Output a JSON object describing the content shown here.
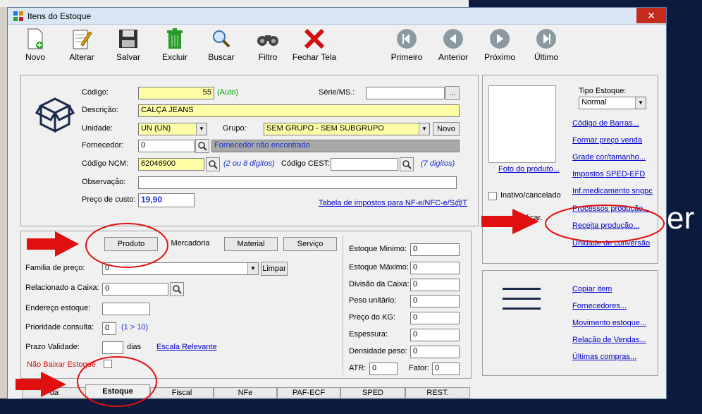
{
  "window": {
    "title": "Itens do Estoque",
    "close_glyph": "✕"
  },
  "toolbar": [
    {
      "label": "Novo",
      "icon": "new-document-icon"
    },
    {
      "label": "Alterar",
      "icon": "edit-notepad-icon"
    },
    {
      "label": "Salvar",
      "icon": "floppy-disk-icon"
    },
    {
      "label": "Excluir",
      "icon": "trash-can-icon"
    },
    {
      "label": "Buscar",
      "icon": "magnifier-icon"
    },
    {
      "label": "Filtro",
      "icon": "binoculars-icon"
    },
    {
      "label": "Fechar Tela",
      "icon": "red-x-icon"
    },
    {
      "label": "Primeiro",
      "icon": "first-icon"
    },
    {
      "label": "Anterior",
      "icon": "previous-icon"
    },
    {
      "label": "Próximo",
      "icon": "next-icon"
    },
    {
      "label": "Último",
      "icon": "last-icon"
    }
  ],
  "form": {
    "codigo_label": "Código:",
    "codigo_value": "55",
    "codigo_auto": "(Auto)",
    "serie_label": "Série/MS.:",
    "serie_value": "",
    "serie_btn": "...",
    "descricao_label": "Descrição:",
    "descricao_value": "CALÇA JEANS",
    "unidade_label": "Unidade:",
    "unidade_value": "UN (UN)",
    "grupo_label": "Grupo:",
    "grupo_value": "SEM GRUPO - SEM SUBGRUPO",
    "novo_btn": "Novo",
    "fornecedor_label": "Fornecedor:",
    "fornecedor_value": "0",
    "fornecedor_status": "Fornecedor não encontrado",
    "ncm_label": "Código NCM:",
    "ncm_value": "62046900",
    "ncm_hint": "(2 ou 8 digitos)",
    "cest_label": "Código CEST:",
    "cest_value": "",
    "cest_hint": "(7 digitos)",
    "obs_label": "Observação:",
    "obs_value": "",
    "preco_label": "Preço de custo:",
    "preco_value": "19,90",
    "impostos_link": "Tabela de impostos para NF-e/NFC-e/S@T"
  },
  "right_panel": {
    "foto_link": "Foto do produto...",
    "tipo_label": "Tipo Estoque:",
    "tipo_value": "Normal",
    "inativo_label": "Inativo/cancelado",
    "partial_label": "licar.",
    "links": [
      "Código de Barras...",
      "Formar preço venda",
      "Grade cor/tamanho...",
      "Impostos SPED-EFD",
      "Inf.medicamento sngpc",
      "Processos produção...",
      "Receita produção...",
      "Unidade de conversão"
    ],
    "links2": [
      "Copiar item",
      "Fornecedores...",
      "Movimento estoque...",
      "Relação de Vendas...",
      "Últimas compras..."
    ]
  },
  "estoque": {
    "type_tabs": [
      "Produto",
      "Mercadoria",
      "Material",
      "Serviço"
    ],
    "familia_label": "Familia de preço:",
    "familia_value": "0",
    "limpar_btn": "Limpar",
    "relacionado_label": "Relacionado a Caixa:",
    "relacionado_value": "0",
    "endereco_label": "Endereço estoque:",
    "endereco_value": "",
    "prioridade_label": "Prioridade consulta:",
    "prioridade_value": "0",
    "prioridade_hint": "(1 > 10)",
    "prazo_label": "Prazo Validade:",
    "prazo_value": "",
    "dias_label": "dias",
    "escala_link": "Escala Relevante",
    "nao_baixar_label": "Não Baixar Estoque",
    "fields": [
      {
        "label": "Estoque Minimo:",
        "value": "0"
      },
      {
        "label": "Estoque Máximo:",
        "value": "0"
      },
      {
        "label": "Divisão da Caixa:",
        "value": "0"
      },
      {
        "label": "Peso unitário:",
        "value": "0"
      },
      {
        "label": "Preço do KG:",
        "value": "0"
      },
      {
        "label": "Espessura:",
        "value": "0"
      },
      {
        "label": "Densidade peso:",
        "value": "0"
      }
    ],
    "atr_label": "ATR:",
    "atr_value": "0",
    "fator_label": "Fator:",
    "fator_value": "0"
  },
  "bottom_tabs": [
    "da",
    "Estoque",
    "Fiscal",
    "NFe",
    "PAF-ECF",
    "SPED",
    "REST."
  ],
  "background_text": "er",
  "colors": {
    "highlight_red": "#e01010",
    "yellow_field": "#ffffa8",
    "link_blue": "#0000cc"
  }
}
